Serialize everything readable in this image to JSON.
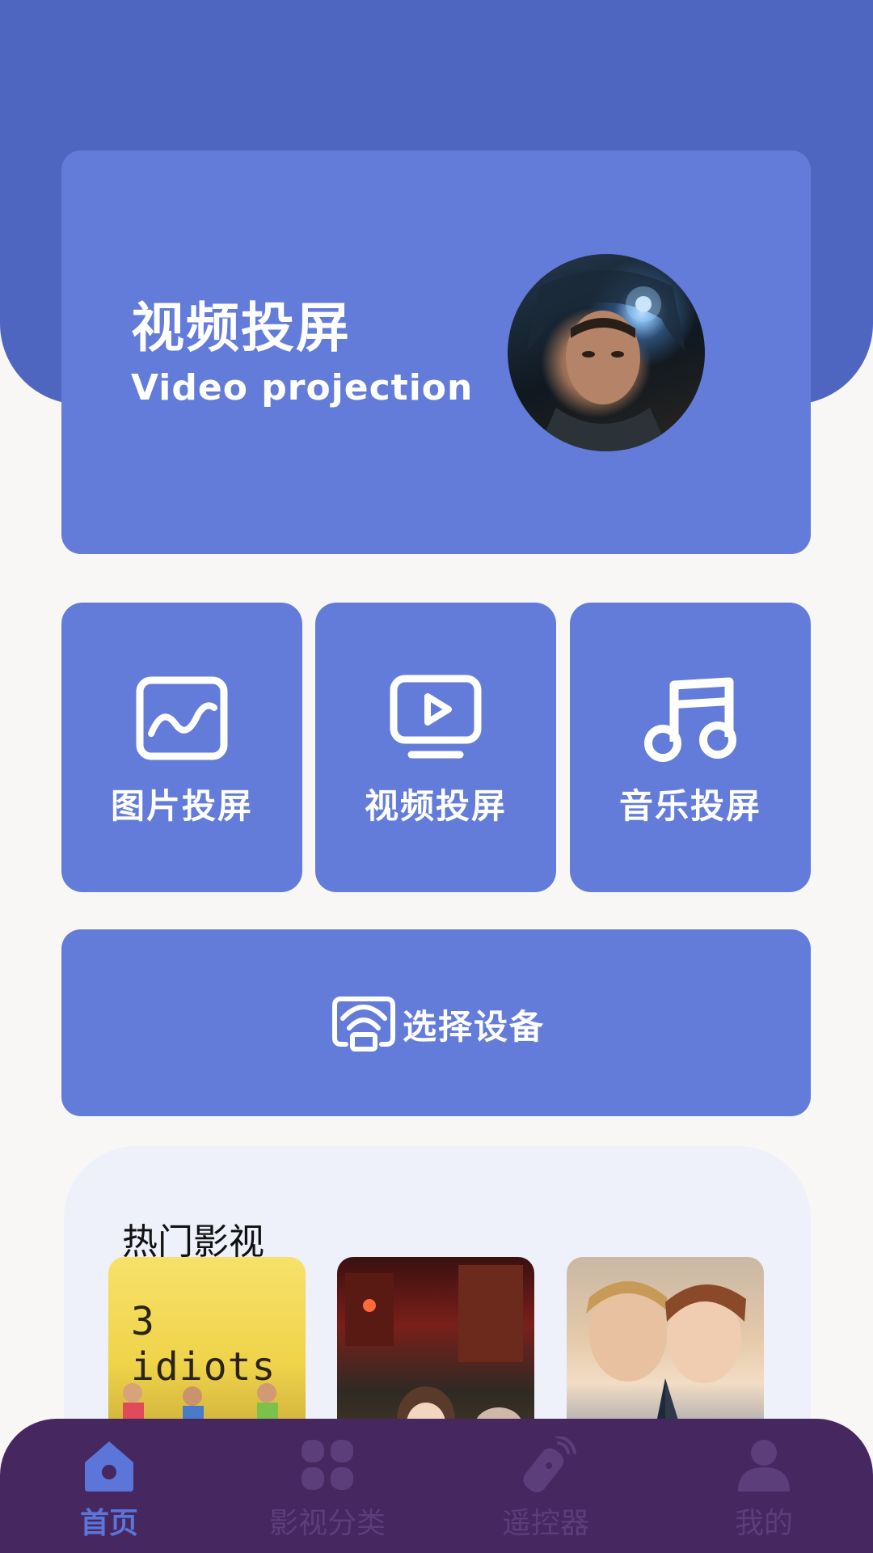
{
  "colors": {
    "header_bg": "#4f66c0",
    "card_bg": "#637cd9",
    "page_bg": "#f8f7f6",
    "panel_bg": "#eef0fa",
    "nav_bg": "#46275f",
    "nav_active": "#5b75d9",
    "nav_inactive": "#5b3e7a"
  },
  "hero": {
    "title": "视频投屏",
    "subtitle": "Video projection",
    "image": "astronaut-movie-still"
  },
  "tiles": [
    {
      "label": "图片投屏",
      "icon": "image-icon"
    },
    {
      "label": "视频投屏",
      "icon": "video-play-icon"
    },
    {
      "label": "音乐投屏",
      "icon": "music-note-icon"
    }
  ],
  "device_button": {
    "label": "选择设备",
    "icon": "cast-screen-icon"
  },
  "hot": {
    "title": "热门影视",
    "posters": [
      {
        "title_art": "3 idiots"
      },
      {
        "title_art": ""
      },
      {
        "title_art": ""
      }
    ]
  },
  "nav": {
    "items": [
      {
        "label": "首页",
        "icon": "home-icon",
        "active": true
      },
      {
        "label": "影视分类",
        "icon": "grid-icon",
        "active": false
      },
      {
        "label": "遥控器",
        "icon": "remote-icon",
        "active": false
      },
      {
        "label": "我的",
        "icon": "user-icon",
        "active": false
      }
    ]
  }
}
